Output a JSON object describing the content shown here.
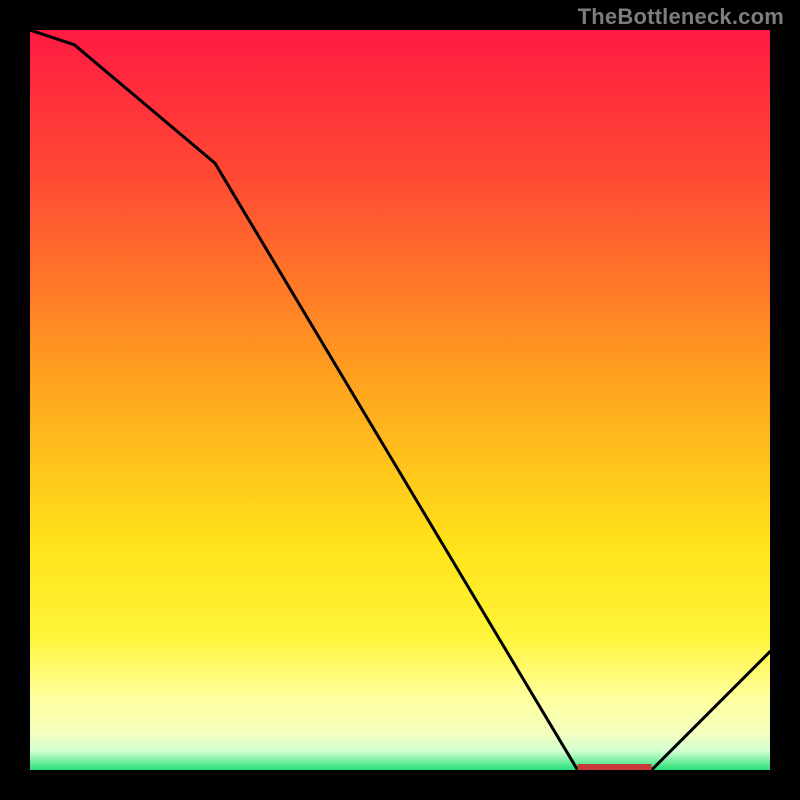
{
  "watermark": "TheBottleneck.com",
  "chart_data": {
    "type": "line",
    "title": "",
    "xlabel": "",
    "ylabel": "",
    "xlim": [
      0,
      100
    ],
    "ylim": [
      0,
      100
    ],
    "grid": false,
    "series": [
      {
        "name": "curve",
        "x": [
          0,
          6,
          25,
          74,
          84,
          100
        ],
        "values": [
          100,
          98,
          82,
          0,
          0,
          16
        ]
      }
    ],
    "gradient_stops": [
      {
        "offset": 0.0,
        "color": "#ff1a42"
      },
      {
        "offset": 0.2,
        "color": "#ff4a33"
      },
      {
        "offset": 0.48,
        "color": "#ffa41e"
      },
      {
        "offset": 0.7,
        "color": "#ffe41a"
      },
      {
        "offset": 0.82,
        "color": "#fff43a"
      },
      {
        "offset": 0.9,
        "color": "#ffff9a"
      },
      {
        "offset": 0.95,
        "color": "#f4ffbf"
      },
      {
        "offset": 0.975,
        "color": "#cfffcf"
      },
      {
        "offset": 1.0,
        "color": "#28e17a"
      }
    ],
    "baseline_marker": {
      "x_start": 74,
      "x_end": 84,
      "color": "#c93a36"
    }
  }
}
